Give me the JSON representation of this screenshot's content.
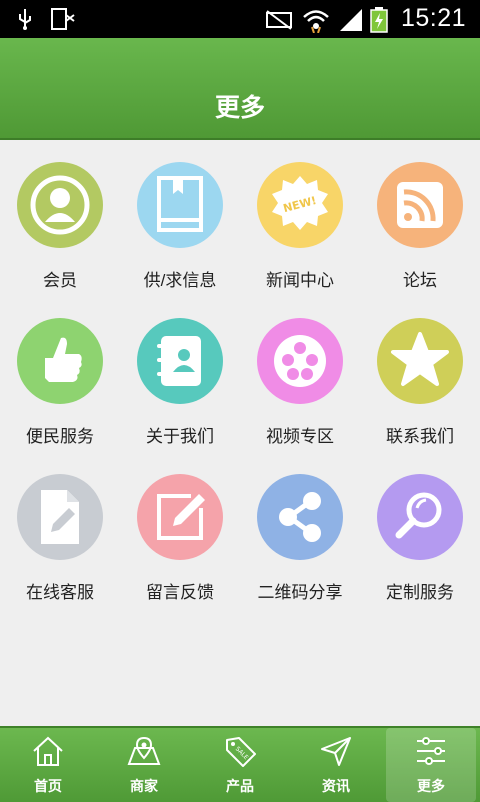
{
  "status_bar": {
    "time": "15:21"
  },
  "header": {
    "title": "更多"
  },
  "colors": {
    "header_green": "#5aa83f",
    "member": "#b3c962",
    "info": "#9cd7f0",
    "news": "#f8d568",
    "forum": "#f6b37b",
    "convenience": "#8ed370",
    "about": "#57c9bd",
    "video": "#f08ce6",
    "contact": "#cfcf58",
    "online": "#c8ccd2",
    "feedback": "#f5a3aa",
    "qrcode": "#8fb2e5",
    "custom": "#b49af0"
  },
  "menu": [
    {
      "label": "会员",
      "icon": "person-icon"
    },
    {
      "label": "供/求信息",
      "icon": "book-icon"
    },
    {
      "label": "新闻中心",
      "icon": "news-badge-icon"
    },
    {
      "label": "论坛",
      "icon": "rss-icon"
    },
    {
      "label": "便民服务",
      "icon": "thumbs-up-icon"
    },
    {
      "label": "关于我们",
      "icon": "contact-book-icon"
    },
    {
      "label": "视频专区",
      "icon": "film-reel-icon"
    },
    {
      "label": "联系我们",
      "icon": "star-icon"
    },
    {
      "label": "在线客服",
      "icon": "document-pen-icon"
    },
    {
      "label": "留言反馈",
      "icon": "edit-icon"
    },
    {
      "label": "二维码分享",
      "icon": "share-icon"
    },
    {
      "label": "定制服务",
      "icon": "magnifier-icon"
    }
  ],
  "badge_text": "NEW!",
  "tabs": [
    {
      "label": "首页",
      "icon": "home-icon"
    },
    {
      "label": "商家",
      "icon": "map-icon"
    },
    {
      "label": "产品",
      "icon": "sale-tag-icon"
    },
    {
      "label": "资讯",
      "icon": "send-icon"
    },
    {
      "label": "更多",
      "icon": "sliders-icon",
      "active": true
    }
  ],
  "tag_text": "SALE"
}
